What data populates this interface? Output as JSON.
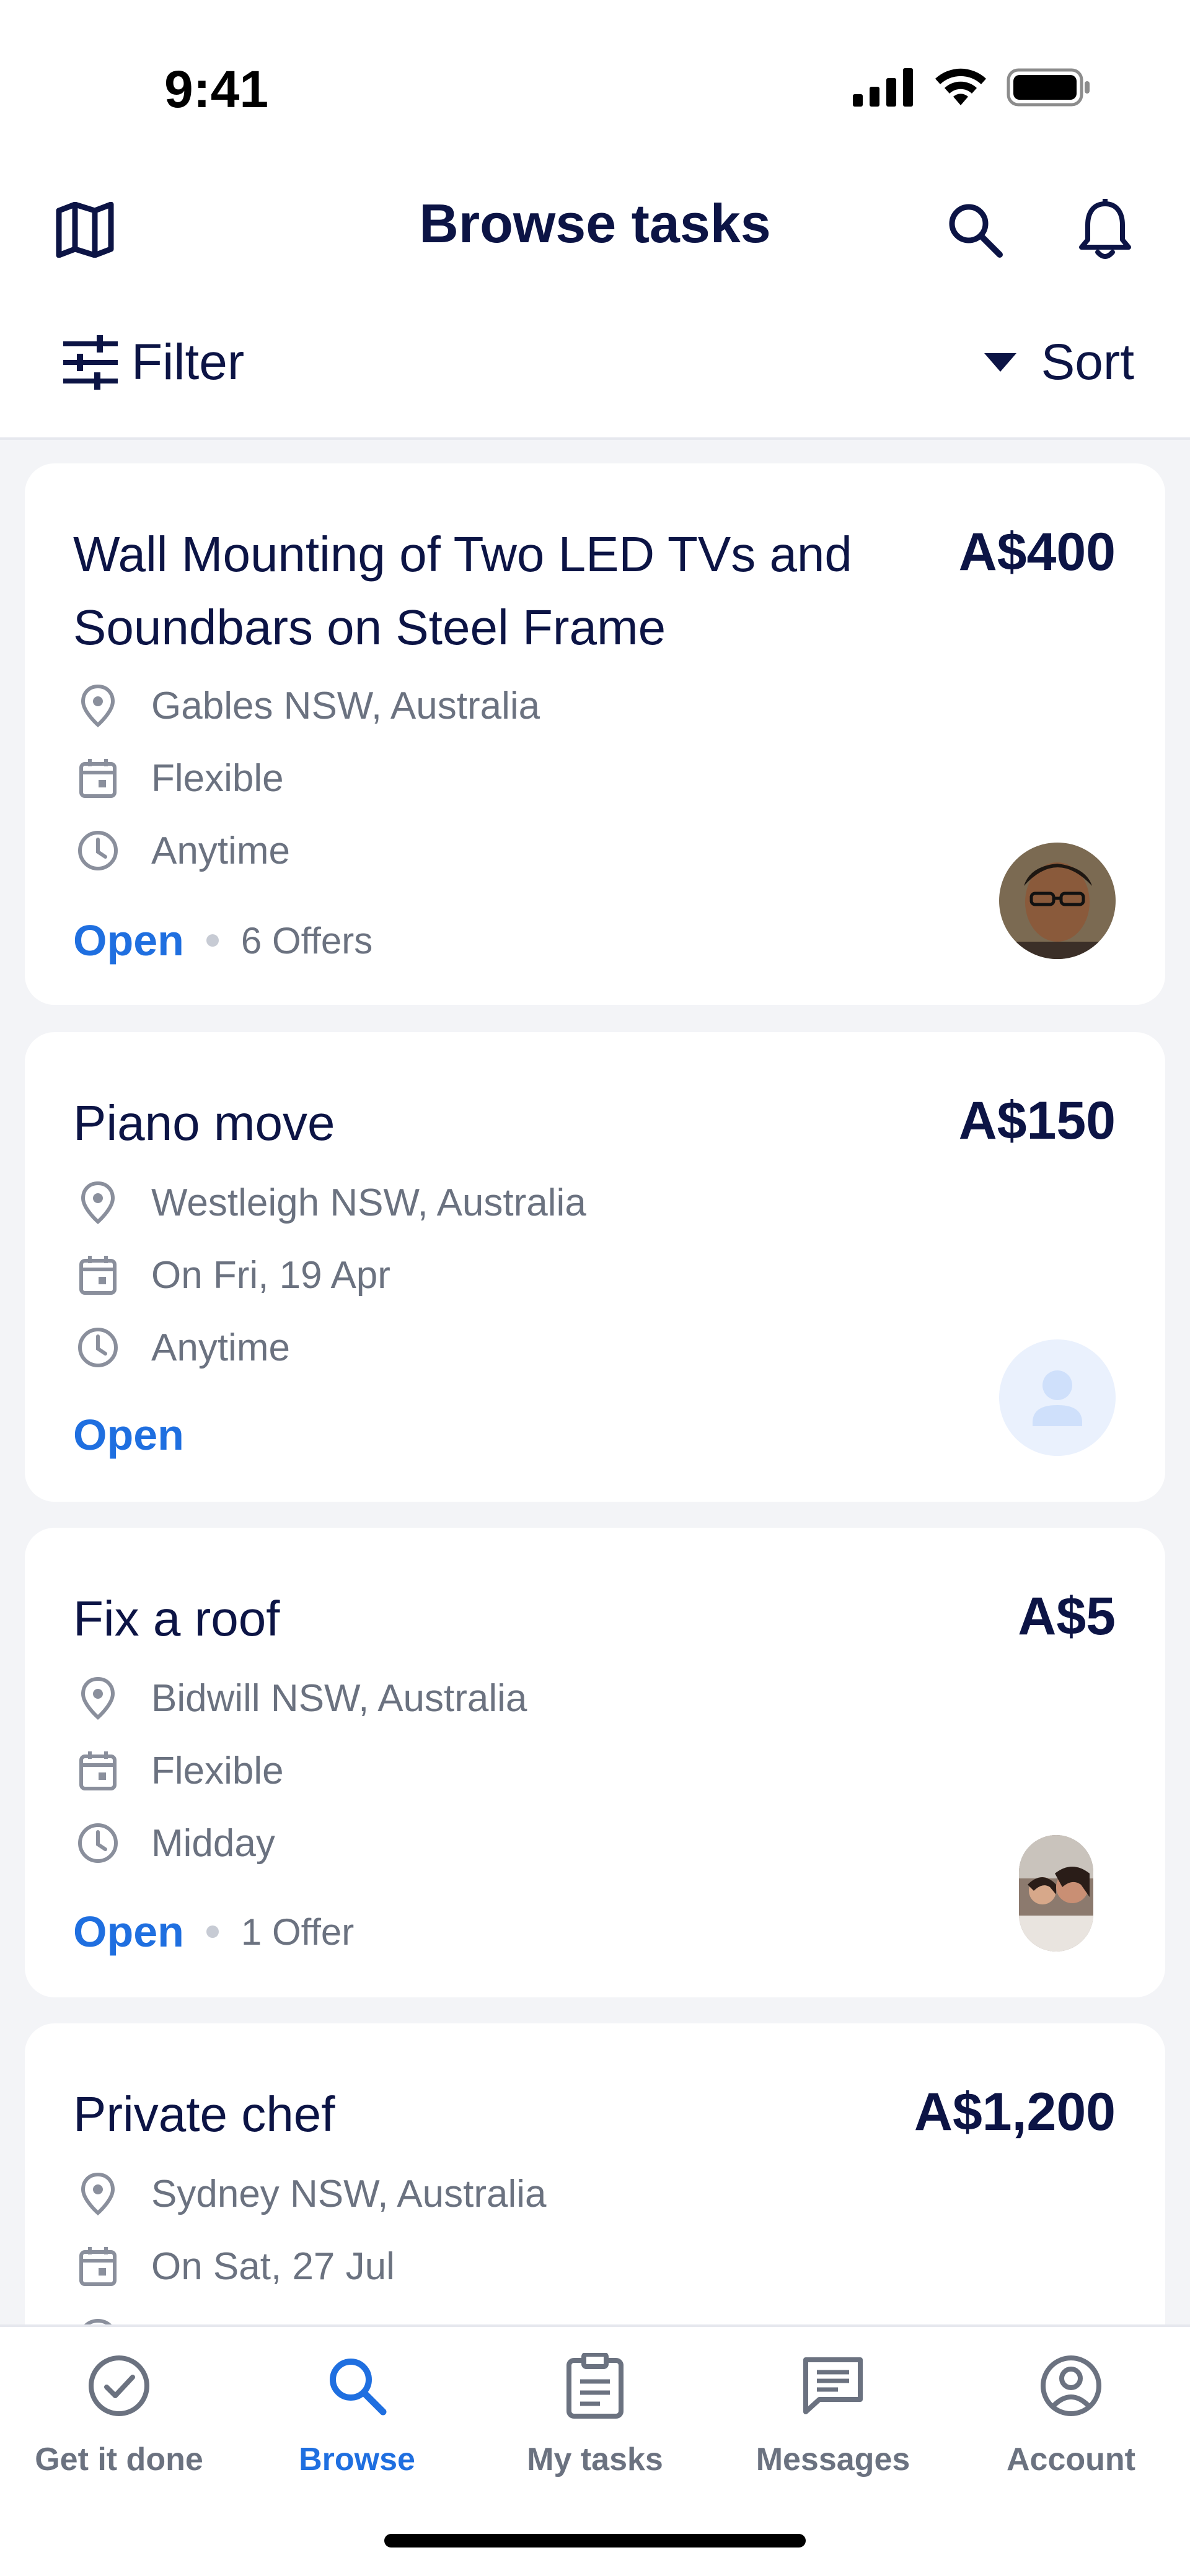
{
  "status_bar": {
    "time": "9:41"
  },
  "header": {
    "title": "Browse tasks",
    "icons": [
      "map-icon",
      "search-icon",
      "bell-icon"
    ]
  },
  "filter_bar": {
    "filter_label": "Filter",
    "sort_label": "Sort"
  },
  "tasks": [
    {
      "title": "Wall Mounting of Two LED TVs and Soundbars on Steel Frame",
      "price": "A$400",
      "location": "Gables NSW, Australia",
      "date": "Flexible",
      "time": "Anytime",
      "status": "Open",
      "offers": "6 Offers"
    },
    {
      "title": "Piano move",
      "price": "A$150",
      "location": "Westleigh NSW, Australia",
      "date": "On Fri, 19 Apr",
      "time": "Anytime",
      "status": "Open",
      "offers": ""
    },
    {
      "title": "Fix a roof",
      "price": "A$5",
      "location": "Bidwill NSW, Australia",
      "date": "Flexible",
      "time": "Midday",
      "status": "Open",
      "offers": "1 Offer"
    },
    {
      "title": "Private chef",
      "price": "A$1,200",
      "location": "Sydney NSW, Australia",
      "date": "On Sat, 27 Jul"
    }
  ],
  "bottom_nav": {
    "items": [
      {
        "label": "Get it done",
        "icon": "check-circle-icon",
        "active": false
      },
      {
        "label": "Browse",
        "icon": "search-icon",
        "active": true
      },
      {
        "label": "My tasks",
        "icon": "clipboard-icon",
        "active": false
      },
      {
        "label": "Messages",
        "icon": "chat-icon",
        "active": false
      },
      {
        "label": "Account",
        "icon": "account-icon",
        "active": false
      }
    ]
  },
  "colors": {
    "accent": "#1f6fe0",
    "navy": "#0c1445",
    "muted": "#6b7280",
    "background": "#f3f4f7"
  }
}
